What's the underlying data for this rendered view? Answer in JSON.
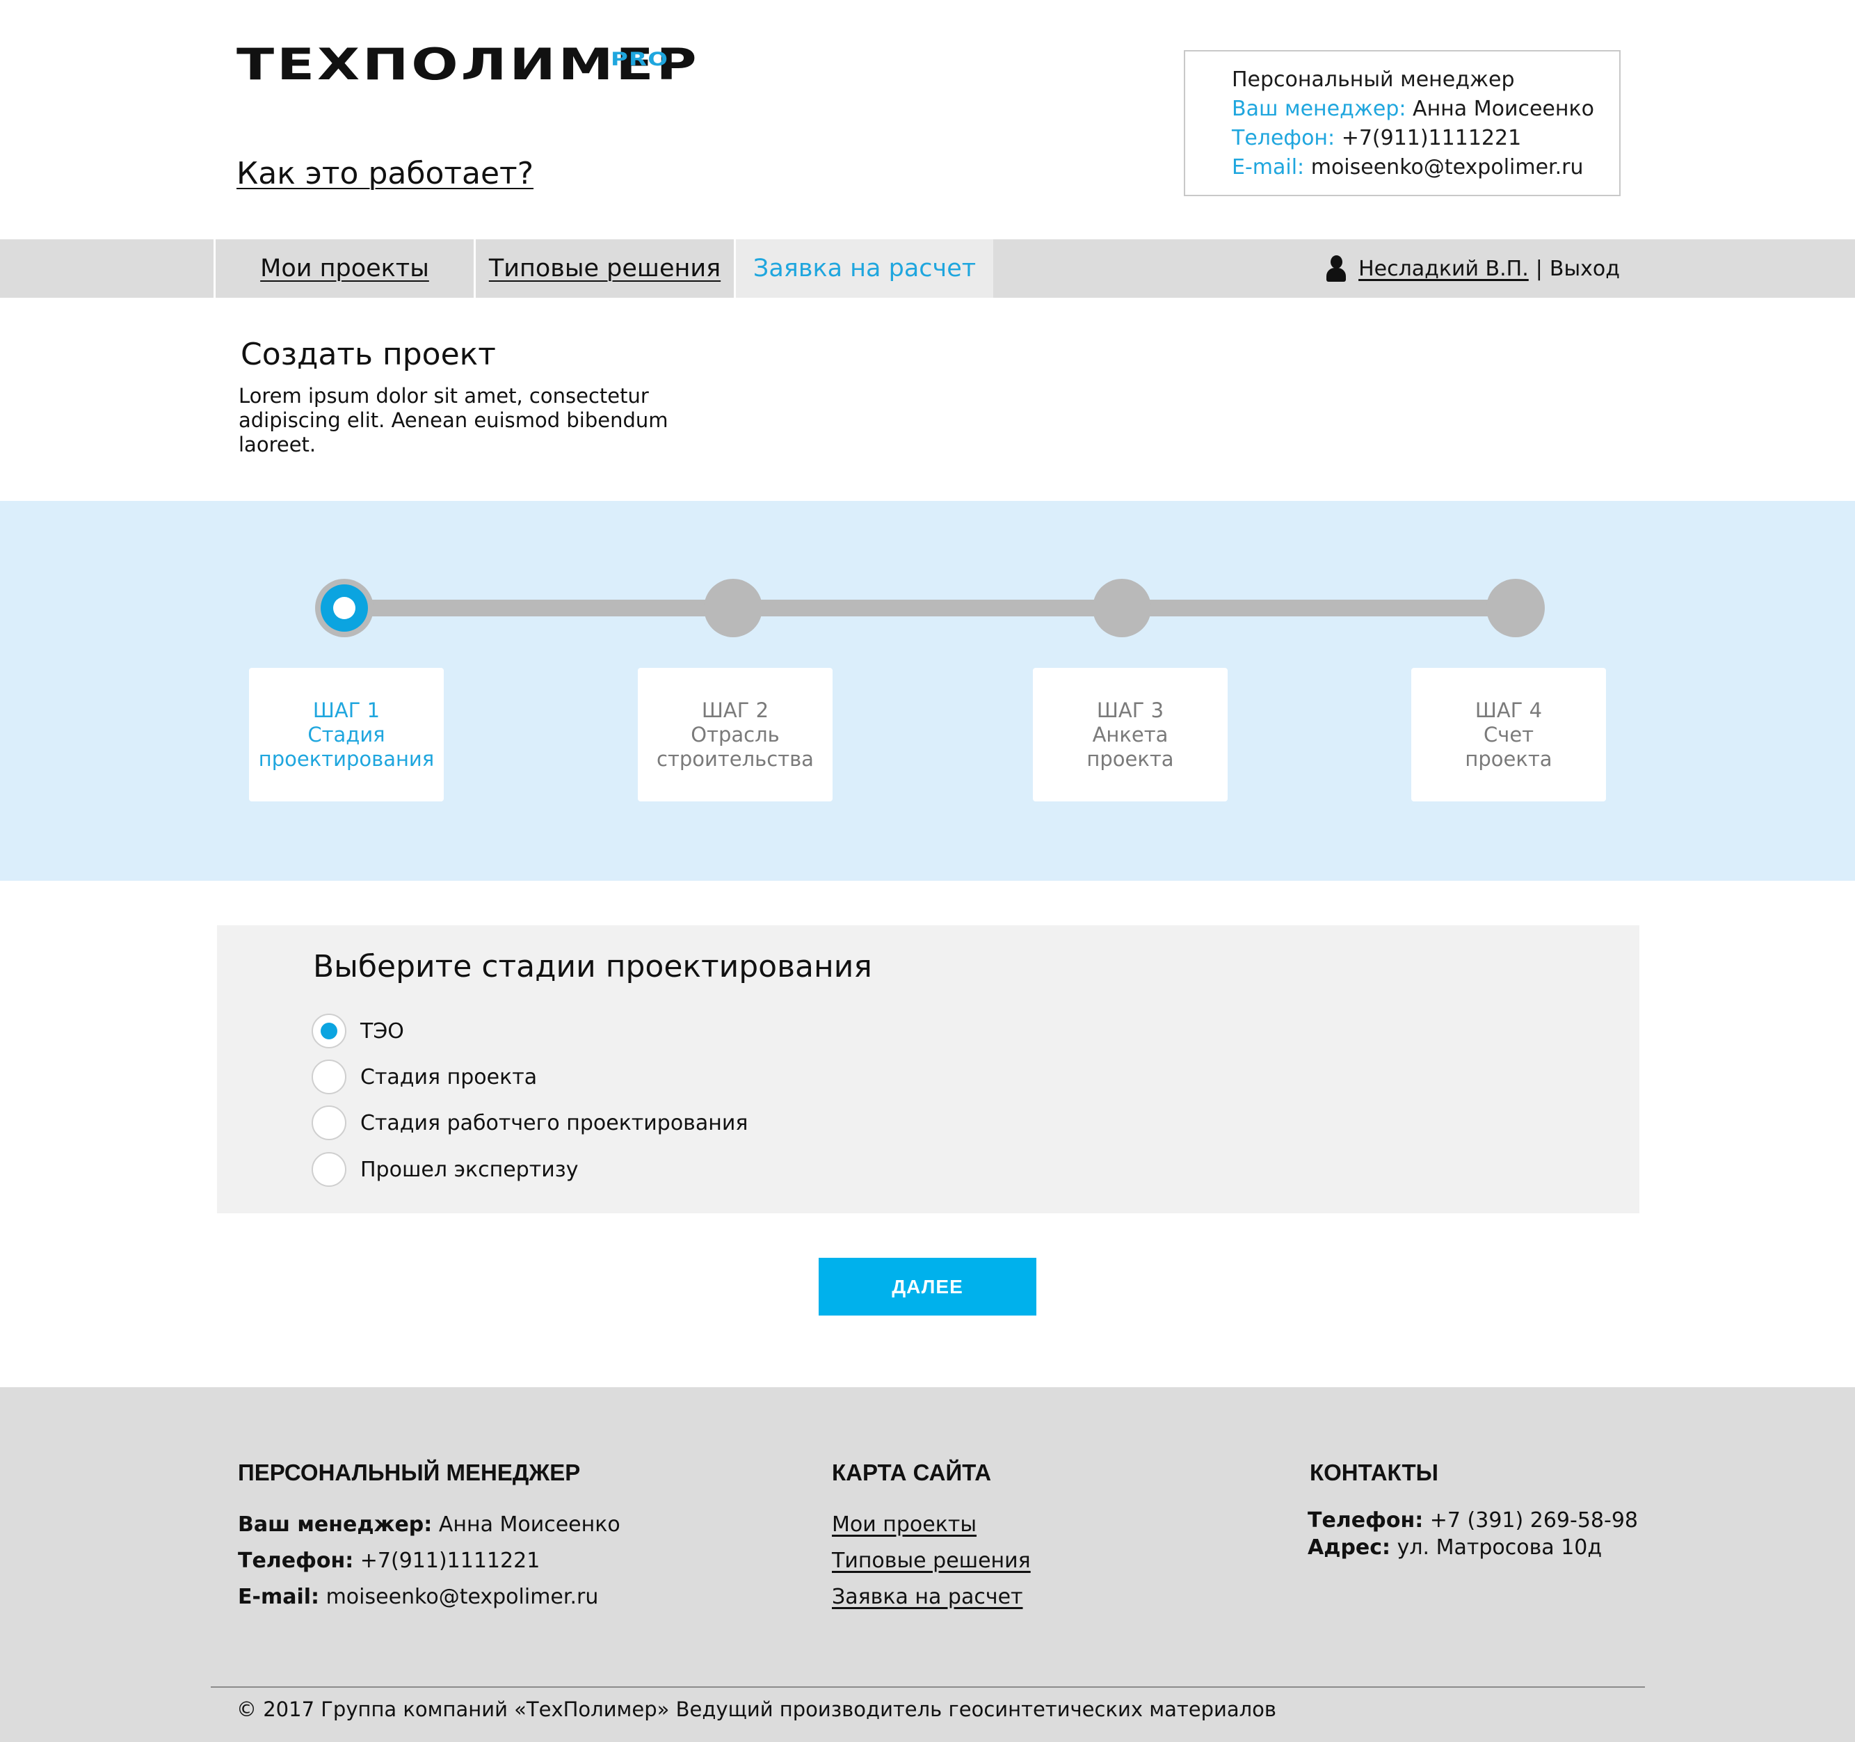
{
  "header": {
    "logo": {
      "main": "ТЕХПОЛИМЕР",
      "suffix": "PRO"
    },
    "how_link": "Как это работает?",
    "manager_box": {
      "title": "Персональный менеджер",
      "manager_label": "Ваш менеджер:",
      "manager_value": "Анна Моисеенко",
      "phone_label": "Телефон:",
      "phone_value": "+7(911)1111221",
      "email_label": "E-mail:",
      "email_value": "moiseenko@texpolimer.ru"
    }
  },
  "nav": {
    "tabs": [
      {
        "label": "Мои проекты",
        "active": false
      },
      {
        "label": "Типовые решения",
        "active": false
      },
      {
        "label": "Заявка на расчет",
        "active": true
      }
    ],
    "user": {
      "name": "Несладкий В.П.",
      "separator": "|",
      "logout": "Выход"
    }
  },
  "intro": {
    "title": "Создать проект",
    "description": "Lorem ipsum dolor sit amet, consectetur adipiscing elit. Aenean euismod bibendum laoreet."
  },
  "stepper": {
    "steps": [
      {
        "step": "ШАГ 1",
        "line1": "Стадия",
        "line2": "проектирования",
        "active": true
      },
      {
        "step": "ШАГ 2",
        "line1": "Отрасль",
        "line2": "строительства",
        "active": false
      },
      {
        "step": "ШАГ 3",
        "line1": "Анкета",
        "line2": "проекта",
        "active": false
      },
      {
        "step": "ШАГ 4",
        "line1": "Счет",
        "line2": "проекта",
        "active": false
      }
    ]
  },
  "form": {
    "title": "Выберите стадии проектирования",
    "options": [
      {
        "label": "ТЭО",
        "checked": true
      },
      {
        "label": "Стадия проекта",
        "checked": false
      },
      {
        "label": "Стадия работчего проектирования",
        "checked": false
      },
      {
        "label": "Прошел экспертизу",
        "checked": false
      }
    ],
    "next_label": "ДАЛЕЕ"
  },
  "footer": {
    "manager": {
      "heading": "ПЕРСОНАЛЬНЫЙ МЕНЕДЖЕР",
      "manager_label": "Ваш менеджер:",
      "manager_value": "Анна Моисеенко",
      "phone_label": "Телефон:",
      "phone_value": "+7(911)1111221",
      "email_label": "E-mail:",
      "email_value": "moiseenko@texpolimer.ru"
    },
    "sitemap": {
      "heading": "КАРТА САЙТА",
      "links": [
        "Мои проекты",
        "Типовые решения",
        "Заявка на расчет"
      ]
    },
    "contacts": {
      "heading": "КОНТАКТЫ",
      "phone_label": "Телефон:",
      "phone_value": "+7 (391) 269-58-98",
      "address_label": "Адрес:",
      "address_value": "ул. Матросова 10д"
    },
    "copyright": "© 2017 Группа компаний «ТехПолимер» Ведущий производитель геосинтетических материалов"
  },
  "colors": {
    "accent": "#1fa6de",
    "button": "#00b1ec",
    "nav_bg": "#dcdcdc",
    "stepper_bg": "#dbeefb",
    "form_bg": "#f1f1f1"
  }
}
